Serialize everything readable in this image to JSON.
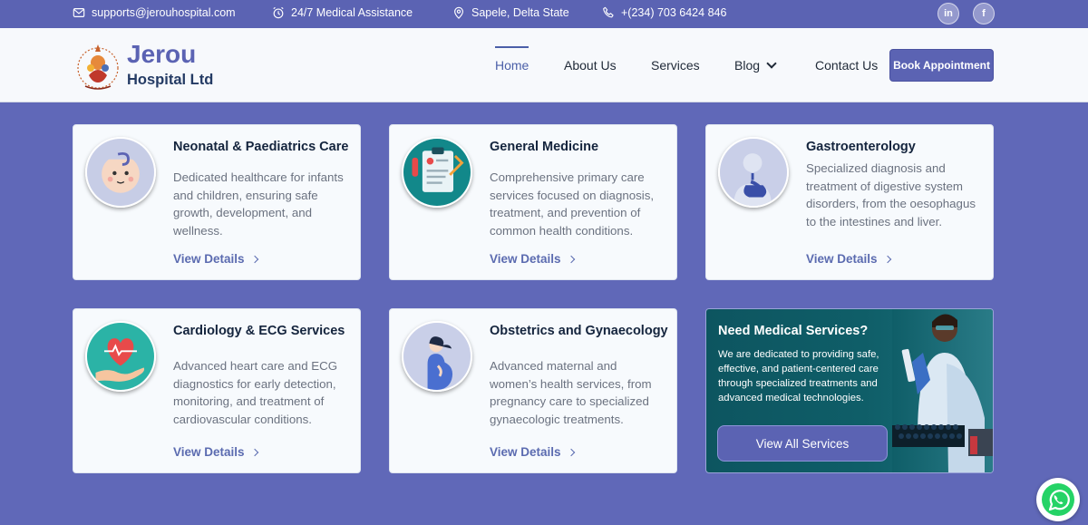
{
  "topbar": {
    "email": "supports@jerouhospital.com",
    "assistance": "24/7 Medical Assistance",
    "location": "Sapele, Delta State",
    "phone": "+(234) 703 6424 846",
    "social": [
      {
        "icon": "linkedin-icon",
        "glyph": "in"
      },
      {
        "icon": "facebook-icon",
        "glyph": "f"
      }
    ]
  },
  "header": {
    "brand_line1": "Jerou",
    "brand_line2": "Hospital Ltd",
    "nav": [
      {
        "label": "Home",
        "active": true
      },
      {
        "label": "About Us"
      },
      {
        "label": "Services"
      },
      {
        "label": "Blog"
      },
      {
        "label": "Contact Us"
      }
    ],
    "cta": "Book Appointment"
  },
  "services": [
    {
      "title": "Neonatal & Paediatrics Care",
      "description": "Dedicated healthcare for infants and children, ensuring safe growth, development, and wellness.",
      "link": "View Details",
      "icon": "baby-icon"
    },
    {
      "title": "General Medicine",
      "description": "Comprehensive primary care services focused on diagnosis, treatment, and prevention of common health conditions.",
      "link": "View Details",
      "icon": "clipboard-stethoscope-icon"
    },
    {
      "title": "Gastroenterology",
      "description": "Specialized diagnosis and treatment of digestive system disorders, from the oesophagus to the intestines and liver.",
      "link": "View Details",
      "icon": "digestive-system-icon"
    },
    {
      "title": "Cardiology & ECG Services",
      "description": "Advanced heart care and ECG diagnostics for early detection, monitoring, and treatment of cardiovascular conditions.",
      "link": "View Details",
      "icon": "heart-hand-icon"
    },
    {
      "title": "Obstetrics and Gynaecology",
      "description": "Advanced maternal and women’s health services, from pregnancy care to specialized gynaecologic treatments.",
      "link": "View Details",
      "icon": "pregnant-woman-icon"
    }
  ],
  "promo": {
    "title": "Need Medical Services?",
    "description": "We are dedicated to providing safe, effective, and patient-centered care through specialized treatments and advanced medical technologies.",
    "button": "View All Services"
  },
  "colors": {
    "page_bg": "#6068b8",
    "accent": "#5b63b3",
    "title": "#14243d",
    "promo_bg": "#0f5e68"
  }
}
